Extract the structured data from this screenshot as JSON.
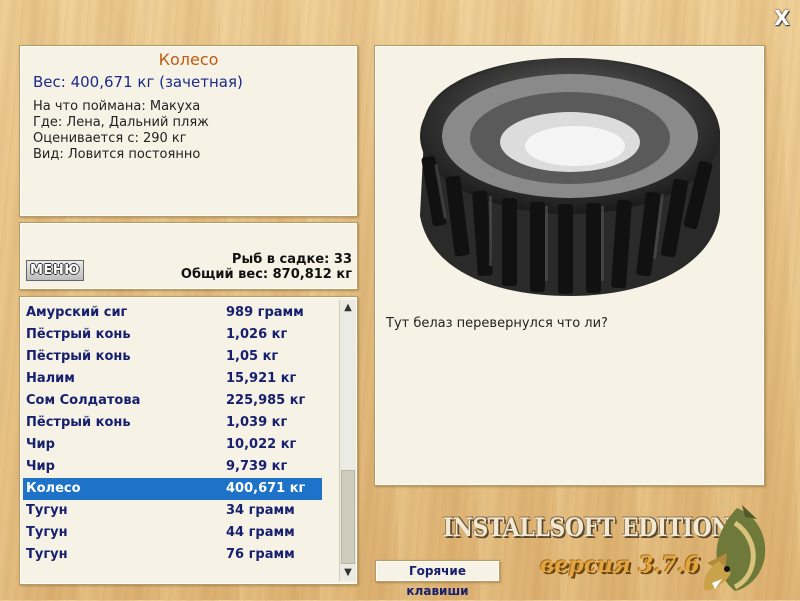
{
  "close_label": "X",
  "catch": {
    "title": "Колесо",
    "weight": "Вес: 400,671 кг (зачетная)",
    "details": [
      "На что поймана: Макуха",
      "Где: Лена, Дальний пляж",
      "Оценивается с: 290 кг",
      "Вид: Ловится постоянно"
    ]
  },
  "stats": {
    "menu_label": "МЕНЮ",
    "fish_in_cage": "Рыб в садке: 33",
    "total_weight": "Общий вес: 870,812 кг"
  },
  "list": {
    "rows": [
      {
        "name": "Амурский сиг",
        "weight": "989 грамм",
        "selected": false
      },
      {
        "name": "Пёстрый конь",
        "weight": "1,026 кг",
        "selected": false
      },
      {
        "name": "Пёстрый конь",
        "weight": "1,05 кг",
        "selected": false
      },
      {
        "name": "Налим",
        "weight": "15,921 кг",
        "selected": false
      },
      {
        "name": "Сом Солдатова",
        "weight": "225,985 кг",
        "selected": false
      },
      {
        "name": "Пёстрый конь",
        "weight": "1,039 кг",
        "selected": false
      },
      {
        "name": "Чир",
        "weight": "10,022 кг",
        "selected": false
      },
      {
        "name": "Чир",
        "weight": "9,739 кг",
        "selected": false
      },
      {
        "name": "Колесо",
        "weight": "400,671 кг",
        "selected": true
      },
      {
        "name": "Тугун",
        "weight": "34 грамм",
        "selected": false
      },
      {
        "name": "Тугун",
        "weight": "44 грамм",
        "selected": false
      },
      {
        "name": "Тугун",
        "weight": "76 грамм",
        "selected": false
      }
    ]
  },
  "picture": {
    "caption": "Тут белаз перевернулся что ли?"
  },
  "footer": {
    "hotkeys_label": "Горячие клавиши",
    "edition": "INSTALLSOFT EDITION",
    "version": "версия 3.7.6"
  },
  "colors": {
    "title": "#c05a10",
    "weight": "#1a2a8a",
    "list_text": "#16206e",
    "selection": "#1e73c8"
  }
}
